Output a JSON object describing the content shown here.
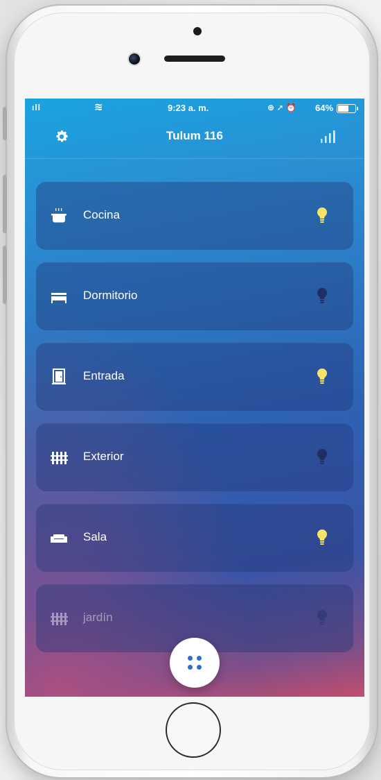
{
  "status_bar": {
    "signal": "ıll",
    "wifi": "≋",
    "time": "9:23 a. m.",
    "status_icons": "⊕ ➚ ⏰",
    "battery_percent": "64%",
    "battery_level": 0.64
  },
  "header": {
    "title": "Tulum 116",
    "settings_icon": "gear-icon",
    "stats_icon": "bar-chart-icon"
  },
  "rooms": [
    {
      "label": "Cocina",
      "icon": "cooking-pot-icon",
      "light_on": true
    },
    {
      "label": "Dormitorio",
      "icon": "bed-icon",
      "light_on": false
    },
    {
      "label": "Entrada",
      "icon": "door-icon",
      "light_on": true
    },
    {
      "label": "Exterior",
      "icon": "fence-icon",
      "light_on": false
    },
    {
      "label": "Sala",
      "icon": "sofa-icon",
      "light_on": true
    },
    {
      "label": "jardín",
      "icon": "fence-icon",
      "light_on": false
    }
  ],
  "fab": {
    "icon": "grid-dots-icon"
  },
  "colors": {
    "bulb_on": "#f5e36a",
    "bulb_off": "#1f2f66",
    "accent": "#2f6fc4"
  }
}
